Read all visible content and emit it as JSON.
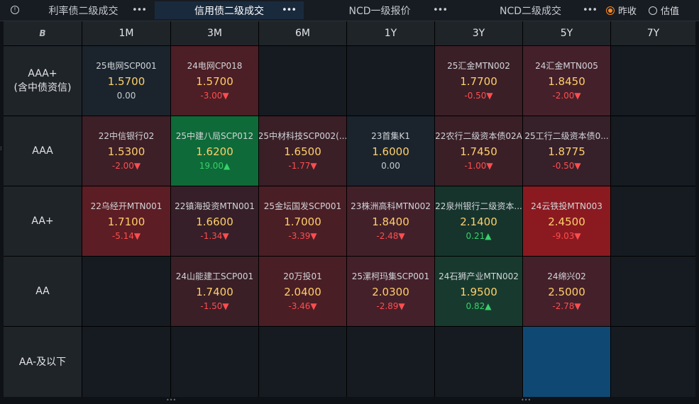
{
  "tabs": [
    {
      "label": "利率债二级成交",
      "active": false
    },
    {
      "label": "信用债二级成交",
      "active": true
    },
    {
      "label": "NCD一级报价",
      "active": false
    },
    {
      "label": "NCD二级成交",
      "active": false
    }
  ],
  "tab_more_label": "•••",
  "info_icon_glyph": "!",
  "mode_options": [
    {
      "label": "昨收",
      "selected": true
    },
    {
      "label": "估值",
      "selected": false
    }
  ],
  "corner_logo": "B",
  "columns": [
    "1M",
    "3M",
    "6M",
    "1Y",
    "3Y",
    "5Y",
    "7Y"
  ],
  "rows": [
    {
      "label": "AAA+\n(含中债资信)",
      "cells": [
        {
          "name": "25电网SCP001",
          "yield": "1.5700",
          "change": "0.00",
          "dir": "flat",
          "bg": "#1b242d"
        },
        {
          "name": "24电网CP018",
          "yield": "1.5700",
          "change": "-3.00▼",
          "dir": "down",
          "bg": "#4c1e25"
        },
        null,
        null,
        {
          "name": "25汇金MTN002",
          "yield": "1.7700",
          "change": "-0.50▼",
          "dir": "down",
          "bg": "#3a1f27"
        },
        {
          "name": "24汇金MTN005",
          "yield": "1.8450",
          "change": "-2.00▼",
          "dir": "down",
          "bg": "#44202a"
        },
        null
      ]
    },
    {
      "label": "AAA",
      "cells": [
        {
          "name": "22中信银行02",
          "yield": "1.5300",
          "change": "-2.00▼",
          "dir": "down",
          "bg": "#3d1f27"
        },
        {
          "name": "25中建八局SCP012",
          "yield": "1.6200",
          "change": "19.00▲",
          "dir": "up",
          "bg": "#0e6a38"
        },
        {
          "name": "25中材科技SCP002(...",
          "yield": "1.6500",
          "change": "-1.77▼",
          "dir": "down",
          "bg": "#3a1f27"
        },
        {
          "name": "23首集K1",
          "yield": "1.6000",
          "change": "0.00",
          "dir": "flat",
          "bg": "#1b242d"
        },
        {
          "name": "22农行二级资本债02A",
          "yield": "1.7450",
          "change": "-1.00▼",
          "dir": "down",
          "bg": "#3a1f27"
        },
        {
          "name": "25工行二级资本债0...",
          "yield": "1.8775",
          "change": "-0.50▼",
          "dir": "down",
          "bg": "#36202a"
        },
        null
      ]
    },
    {
      "label": "AA+",
      "cells": [
        {
          "name": "22乌经开MTN001",
          "yield": "1.7100",
          "change": "-5.14▼",
          "dir": "down",
          "bg": "#5c1d24"
        },
        {
          "name": "22镇海投资MTN001",
          "yield": "1.6600",
          "change": "-1.34▼",
          "dir": "down",
          "bg": "#361f28"
        },
        {
          "name": "25金坛国发SCP001",
          "yield": "1.7000",
          "change": "-3.39▼",
          "dir": "down",
          "bg": "#4a1e25"
        },
        {
          "name": "23株洲高科MTN002",
          "yield": "1.8400",
          "change": "-2.48▼",
          "dir": "down",
          "bg": "#42202a"
        },
        {
          "name": "22泉州银行二级资本...",
          "yield": "2.1400",
          "change": "0.21▲",
          "dir": "up",
          "bg": "#16342c"
        },
        {
          "name": "24云铁投MTN003",
          "yield": "2.4500",
          "change": "-9.03▼",
          "dir": "down",
          "bg": "#8a1a20"
        },
        null
      ]
    },
    {
      "label": "AA",
      "cells": [
        null,
        {
          "name": "24山能建工SCP001",
          "yield": "1.7400",
          "change": "-1.50▼",
          "dir": "down",
          "bg": "#3a1f27"
        },
        {
          "name": "20万投01",
          "yield": "2.0400",
          "change": "-3.46▼",
          "dir": "down",
          "bg": "#4a1e25"
        },
        {
          "name": "25漯柯玛集SCP001",
          "yield": "2.0300",
          "change": "-2.89▼",
          "dir": "down",
          "bg": "#44202a"
        },
        {
          "name": "24石狮产业MTN002",
          "yield": "1.9500",
          "change": "0.82▲",
          "dir": "up",
          "bg": "#183a2e"
        },
        {
          "name": "24绵兴02",
          "yield": "2.5000",
          "change": "-2.78▼",
          "dir": "down",
          "bg": "#44202a"
        },
        null
      ]
    },
    {
      "label": "AA-及以下",
      "cells": [
        null,
        null,
        null,
        null,
        null,
        {
          "name": "",
          "yield": "",
          "change": "",
          "dir": "flat",
          "bg": "#0f4873"
        },
        null
      ]
    }
  ],
  "colors": {
    "accent_orange": "#ff8a1f",
    "yield_text": "#ffcf6b",
    "down": "#ff4d4f",
    "up": "#37d16a",
    "selected_tab_bg": "#1a2a3d"
  }
}
